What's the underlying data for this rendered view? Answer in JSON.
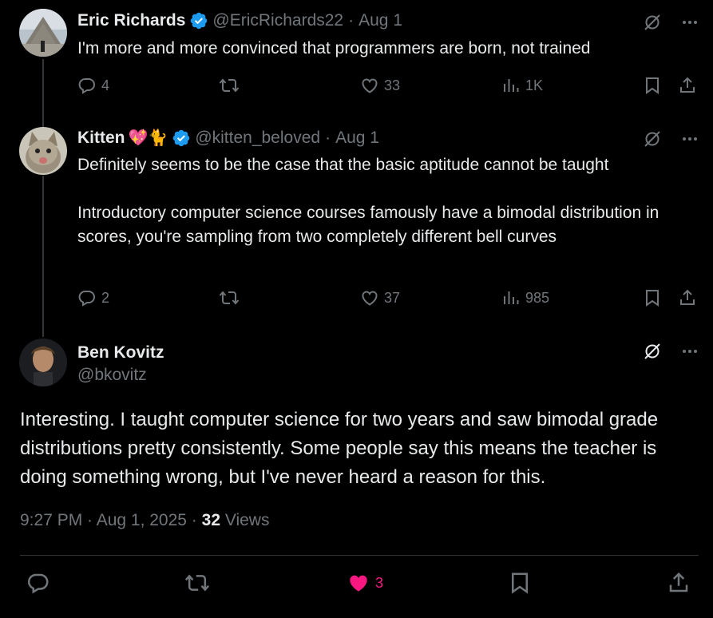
{
  "tweets": [
    {
      "name": "Eric Richards",
      "handle": "@EricRichards22",
      "date": "Aug 1",
      "separator": "·",
      "text": "I'm more and more convinced that programmers are born, not trained",
      "replies": "4",
      "likes": "33",
      "views": "1K"
    },
    {
      "name": "Kitten",
      "name_emoji": "💖🐈",
      "handle": "@kitten_beloved",
      "date": "Aug 1",
      "separator": "·",
      "text_line1": "Definitely seems to be the case that the basic aptitude cannot be taught",
      "text_para2": "Introductory computer science courses famously have a bimodal distribution in scores, you're sampling from two completely different bell curves",
      "replies": "2",
      "likes": "37",
      "views": "985"
    }
  ],
  "main": {
    "name": "Ben Kovitz",
    "handle": "@bkovitz",
    "text": "Interesting. I taught computer science for two years and saw bimodal grade distributions pretty consistently. Some people say this means the teacher is doing something wrong, but I've never heard a reason for this.",
    "time": "9:27 PM · Aug 1, 2025 · ",
    "views_count": "32",
    "views_label": " Views",
    "likes": "3"
  },
  "colors": {
    "background": "#000000",
    "text": "#e7e9ea",
    "muted": "#71767b",
    "verified": "#1d9bf0",
    "like_active": "#f91880"
  },
  "icons": [
    "grok-icon",
    "more-icon",
    "reply-icon",
    "retweet-icon",
    "like-icon",
    "views-icon",
    "bookmark-icon",
    "share-icon",
    "verified-icon"
  ]
}
